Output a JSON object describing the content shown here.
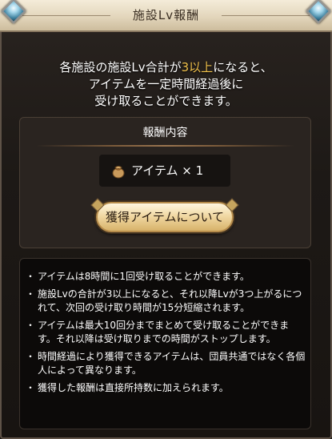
{
  "dialog": {
    "title": "施設Lv報酬"
  },
  "intro": {
    "line1_before": "各施設の施設Lv合計が",
    "line1_highlight": "3以上",
    "line1_after": "になると、",
    "line2": "アイテムを一定時間経過後に",
    "line3": "受け取ることができます。"
  },
  "reward": {
    "heading": "報酬内容",
    "item_icon": "bag-icon",
    "item_text": "アイテム × 1",
    "about_button_label": "獲得アイテムについて"
  },
  "notes": [
    "アイテムは8時間に1回受け取ることができます。",
    "施設Lvの合計が3以上になると、それ以降Lvが3つ上がるにつれて、次回の受け取り時間が15分短縮されます。",
    "アイテムは最大10回分までまとめて受け取ることができます。それ以降は受け取りまでの時間がストップします。",
    "時間経過により獲得できるアイテムは、団員共通ではなく各個人によって異なります。",
    "獲得した報酬は直接所持数に加えられます。"
  ],
  "colors": {
    "highlight": "#f0c14b",
    "title_bar": "#e3d6bc",
    "panel": "#2a2420"
  }
}
